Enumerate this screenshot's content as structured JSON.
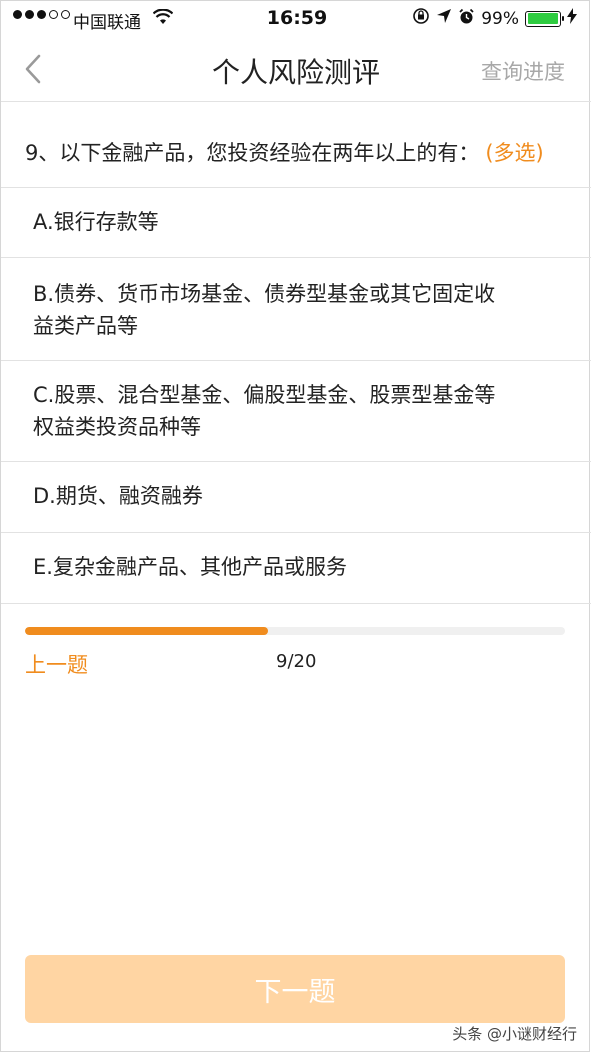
{
  "status_bar": {
    "carrier": "中国联通",
    "time": "16:59",
    "battery": "99%"
  },
  "nav": {
    "title": "个人风险测评",
    "progress_link": "查询进度"
  },
  "question": {
    "text": "9、以下金融产品，您投资经验在两年以上的有：",
    "multi_label": "(多选)"
  },
  "options": [
    {
      "line1": "A.银行存款等",
      "line2": ""
    },
    {
      "line1": "B.债券、货币市场基金、债券型基金或其它固定收",
      "line2": "益类产品等"
    },
    {
      "line1": "C.股票、混合型基金、偏股型基金、股票型基金等",
      "line2": "权益类投资品种等"
    },
    {
      "line1": "D.期货、融资融券",
      "line2": ""
    },
    {
      "line1": "E.复杂金融产品、其他产品或服务",
      "line2": ""
    }
  ],
  "progress": {
    "prev_label": "上一题",
    "counter": "9/20",
    "fraction": 0.45
  },
  "next_label": "下一题",
  "watermark": "头条 @小谜财经行",
  "colors": {
    "accent": "#f08c1e",
    "next_disabled": "#ffd5a3"
  }
}
